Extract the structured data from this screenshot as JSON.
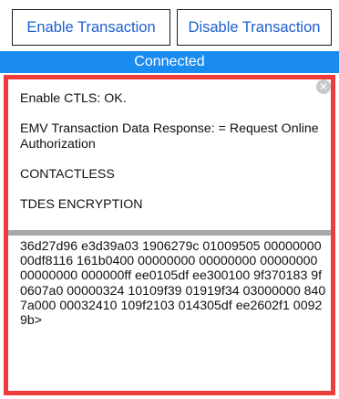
{
  "toolbar": {
    "enable_label": "Enable Transaction",
    "disable_label": "Disable Transaction"
  },
  "status": {
    "text": "Connected"
  },
  "log": {
    "lines": [
      "Enable CTLS: OK.",
      "EMV Transaction Data Response: = Request Online Authorization",
      "CONTACTLESS",
      "TDES ENCRYPTION"
    ],
    "close_icon": "close-icon",
    "hex_data": "36d27d96 e3d39a03 1906279c 01009505 00000000 00df8116 161b0400 00000000 00000000 00000000 00000000 000000ff ee0105df ee300100 9f370183 9f0607a0 00000324 10109f39 01919f34 03000000 8407a000 00032410 109f2103 014305df ee2602f1 00929b>"
  },
  "colors": {
    "accent_text": "#1f5fd1",
    "status_bar": "#1a8cf0",
    "frame": "#ef3b3b",
    "divider": "#a9a9a9"
  }
}
